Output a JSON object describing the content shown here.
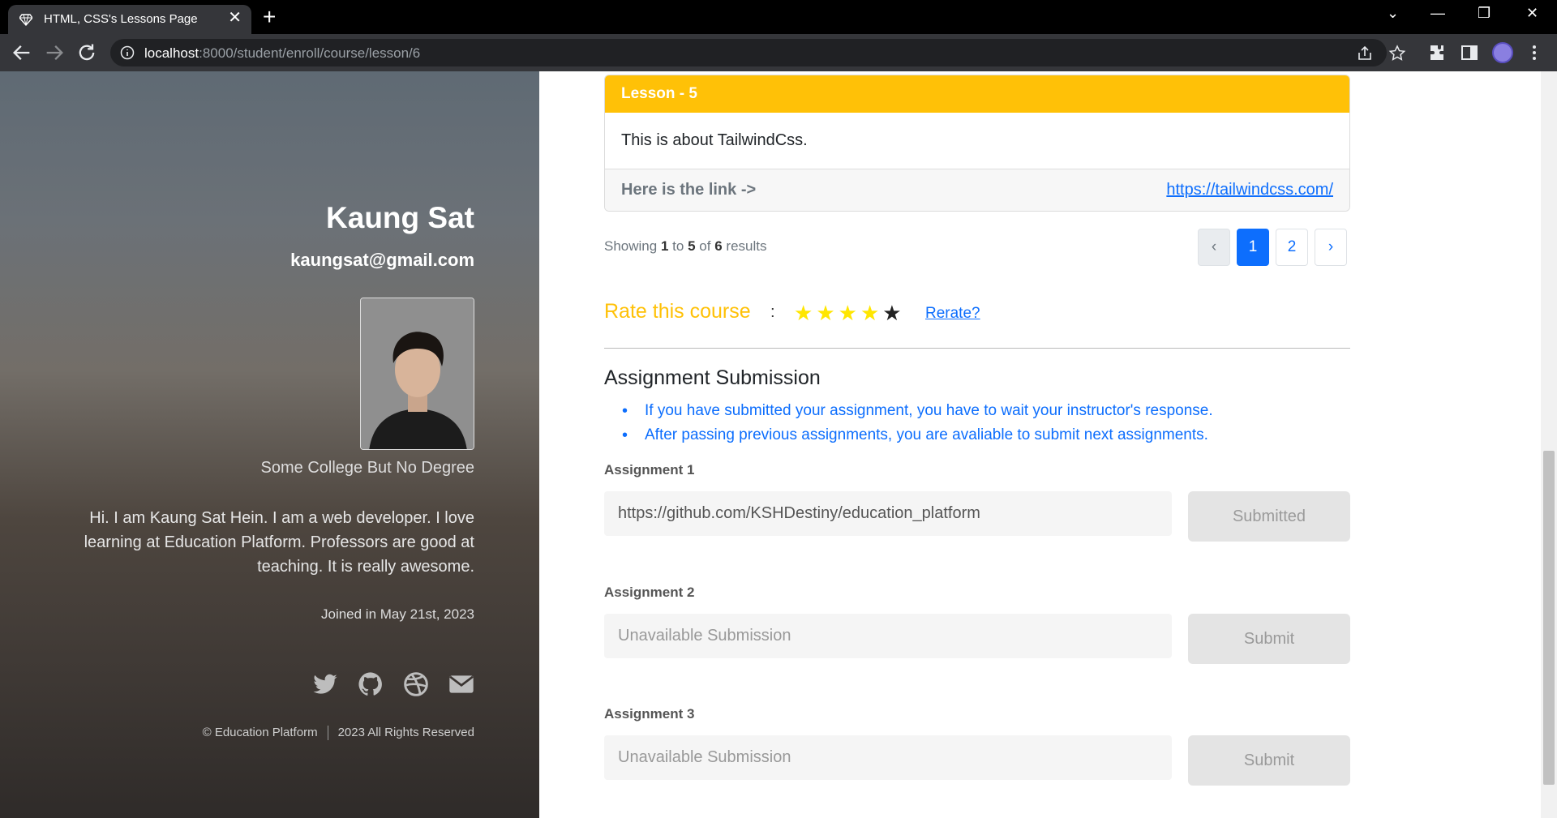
{
  "browser": {
    "tab_title": "HTML, CSS's Lessons Page",
    "tab_close": "✕",
    "new_tab": "+",
    "url_host": "localhost",
    "url_rest": ":8000/student/enroll/course/lesson/6",
    "controls": {
      "collapse": "⌄",
      "minimize": "—",
      "restore": "❐",
      "close": "✕"
    }
  },
  "profile": {
    "name": "Kaung Sat",
    "email": "kaungsat@gmail.com",
    "education": "Some College But No Degree",
    "bio": "Hi. I am Kaung Sat Hein. I am a web developer. I love learning at Education Platform. Professors are good at teaching. It is really awesome.",
    "joined": "Joined in May 21st, 2023",
    "socials": [
      "twitter-icon",
      "github-icon",
      "dribbble-icon",
      "mail-icon"
    ],
    "footer_brand": "© Education Platform",
    "footer_rights": "2023 All Rights Reserved"
  },
  "lesson": {
    "title": "Lesson - 5",
    "description": "This is about TailwindCss.",
    "link_label": "Here is the link ->",
    "link_url": "https://tailwindcss.com/",
    "header_color": "#ffc107"
  },
  "pagination": {
    "showing_prefix": "Showing",
    "from": "1",
    "to_word": "to",
    "to": "5",
    "of_word": "of",
    "total": "6",
    "results_word": "results",
    "prev": "‹",
    "pages": [
      "1",
      "2"
    ],
    "active_page": "1",
    "next": "›"
  },
  "rating": {
    "title": "Rate this course",
    "colon": ":",
    "stars_filled": 4,
    "stars_total": 5,
    "star_glyph": "★",
    "filled_color": "#ffe600",
    "empty_color": "#222222",
    "rerate_label": "Rerate?"
  },
  "assignments": {
    "heading": "Assignment Submission",
    "notes": [
      "If you have submitted your assignment, you have to wait your instructor's response.",
      "After passing previous assignments, you are avaliable to submit next assignments."
    ],
    "items": [
      {
        "label": "Assignment 1",
        "value": "https://github.com/KSHDestiny/education_platform",
        "placeholder": "",
        "button": "Submitted"
      },
      {
        "label": "Assignment 2",
        "value": "",
        "placeholder": "Unavailable Submission",
        "button": "Submit"
      },
      {
        "label": "Assignment 3",
        "value": "",
        "placeholder": "Unavailable Submission",
        "button": "Submit"
      }
    ]
  }
}
